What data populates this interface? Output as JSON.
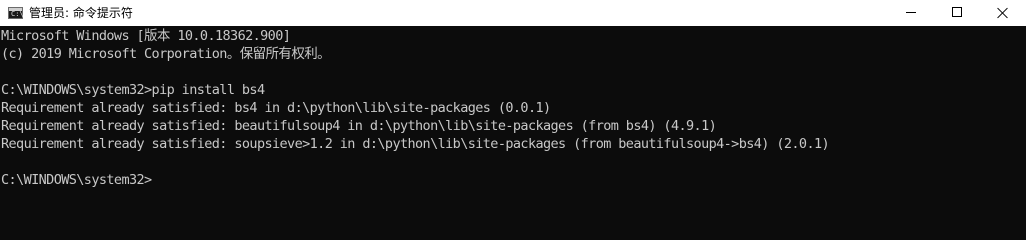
{
  "window": {
    "title": "管理员: 命令提示符",
    "icon": "cmd-icon",
    "controls": {
      "minimize": "minimize-icon",
      "maximize": "maximize-icon",
      "close": "close-icon"
    }
  },
  "console": {
    "lines": [
      "Microsoft Windows [版本 10.0.18362.900]",
      "(c) 2019 Microsoft Corporation。保留所有权利。",
      "",
      "C:\\WINDOWS\\system32>pip install bs4",
      "Requirement already satisfied: bs4 in d:\\python\\lib\\site-packages (0.0.1)",
      "Requirement already satisfied: beautifulsoup4 in d:\\python\\lib\\site-packages (from bs4) (4.9.1)",
      "Requirement already satisfied: soupsieve>1.2 in d:\\python\\lib\\site-packages (from beautifulsoup4->bs4) (2.0.1)",
      "",
      "C:\\WINDOWS\\system32>"
    ]
  },
  "colors": {
    "background": "#0c0c0c",
    "text": "#c8c8c8",
    "titlebar": "#ffffff"
  }
}
